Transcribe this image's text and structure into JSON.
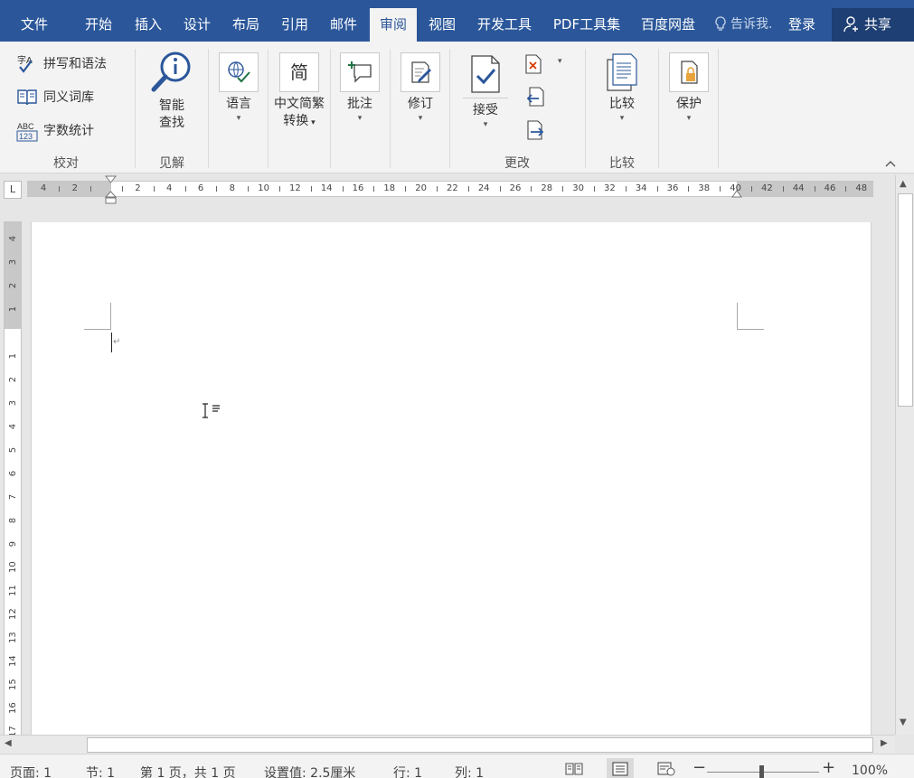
{
  "tabs": [
    {
      "label": "文件",
      "key": "file"
    },
    {
      "label": "开始",
      "key": "home"
    },
    {
      "label": "插入",
      "key": "insert"
    },
    {
      "label": "设计",
      "key": "design"
    },
    {
      "label": "布局",
      "key": "layout"
    },
    {
      "label": "引用",
      "key": "references"
    },
    {
      "label": "邮件",
      "key": "mailings"
    },
    {
      "label": "审阅",
      "key": "review",
      "active": true
    },
    {
      "label": "视图",
      "key": "view"
    },
    {
      "label": "开发工具",
      "key": "developer"
    },
    {
      "label": "PDF工具集",
      "key": "pdf"
    },
    {
      "label": "百度网盘",
      "key": "baidu"
    }
  ],
  "header": {
    "tell_me": "告诉我.",
    "login": "登录",
    "share": "共享",
    "accent": "#2b579a"
  },
  "ribbon": {
    "proofing": {
      "spelling": "拼写和语法",
      "thesaurus": "同义词库",
      "word_count": "字数统计",
      "group": "校对"
    },
    "insights": {
      "smart_lookup_1": "智能",
      "smart_lookup_2": "查找",
      "group": "见解"
    },
    "language": {
      "label": "语言"
    },
    "chinese": {
      "label_1": "中文简繁",
      "label_2": "转换",
      "glyph": "简"
    },
    "comments": {
      "label": "批注"
    },
    "tracking": {
      "label": "修订"
    },
    "changes": {
      "accept": "接受",
      "group": "更改"
    },
    "compare": {
      "label": "比较",
      "group": "比较"
    },
    "protect": {
      "label": "保护"
    }
  },
  "ruler": {
    "corner": "L",
    "h_labels": [
      "4",
      "2",
      "",
      "2",
      "4",
      "6",
      "8",
      "10",
      "12",
      "14",
      "16",
      "18",
      "20",
      "22",
      "24",
      "26",
      "28",
      "30",
      "32",
      "34",
      "36",
      "38",
      "40",
      "42",
      "44",
      "46",
      "48"
    ],
    "v_labels": [
      "4",
      "3",
      "2",
      "1",
      "",
      "1",
      "2",
      "3",
      "4",
      "5",
      "6",
      "7",
      "8",
      "9",
      "10",
      "11",
      "12",
      "13",
      "14",
      "15",
      "16",
      "17"
    ]
  },
  "document": {
    "paragraph_mark": "↵"
  },
  "status": {
    "page": "页面: 1",
    "section": "节: 1",
    "page_of": "第 1 页，共 1 页",
    "setting": "设置值: 2.5厘米",
    "row": "行: 1",
    "col": "列: 1",
    "zoom_minus": "−",
    "zoom_plus": "+",
    "zoom": "100%"
  }
}
